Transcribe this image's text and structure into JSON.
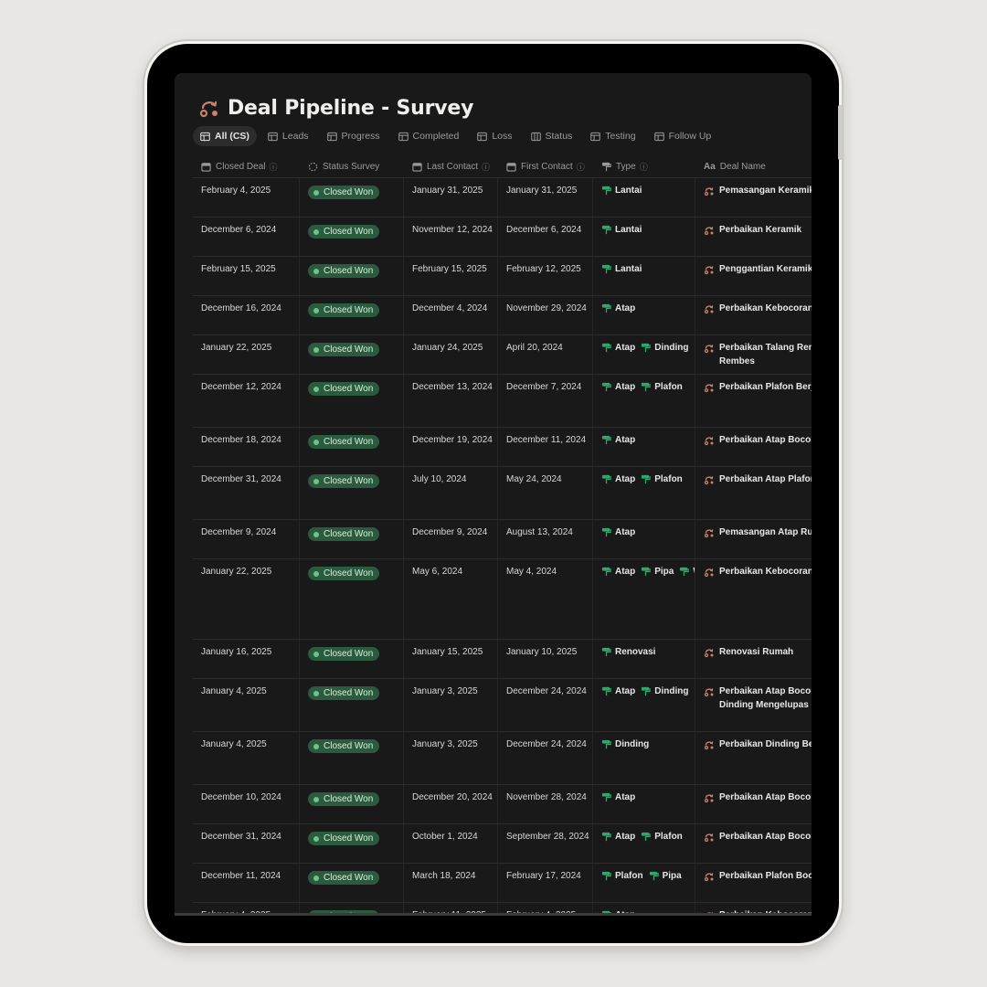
{
  "page": {
    "title": "Deal Pipeline - Survey"
  },
  "tabs": [
    {
      "label": "All (CS)",
      "active": true
    },
    {
      "label": "Leads"
    },
    {
      "label": "Progress"
    },
    {
      "label": "Completed"
    },
    {
      "label": "Loss"
    },
    {
      "label": "Status"
    },
    {
      "label": "Testing"
    },
    {
      "label": "Follow Up"
    }
  ],
  "columns": [
    "Closed Deal",
    "Status Survey",
    "Last Contact",
    "First Contact",
    "Type",
    "Deal Name"
  ],
  "rows": [
    {
      "closed": "February 4, 2025",
      "status": "Closed Won",
      "last": "January 31, 2025",
      "first": "January 31, 2025",
      "types": [
        "Lantai"
      ],
      "deal": "Pemasangan Keramik",
      "h": 42
    },
    {
      "closed": "December 6, 2024",
      "status": "Closed Won",
      "last": "November 12, 2024",
      "first": "December 6, 2024",
      "types": [
        "Lantai"
      ],
      "deal": "Perbaikan Keramik",
      "h": 42
    },
    {
      "closed": "February 15, 2025",
      "status": "Closed Won",
      "last": "February 15, 2025",
      "first": "February 12, 2025",
      "types": [
        "Lantai"
      ],
      "deal": "Penggantian Keramik",
      "h": 42
    },
    {
      "closed": "December 16, 2024",
      "status": "Closed Won",
      "last": "December 4, 2024",
      "first": "November 29, 2024",
      "types": [
        "Atap"
      ],
      "deal": "Perbaikan Kebocoran A",
      "h": 42
    },
    {
      "closed": "January 22, 2025",
      "status": "Closed Won",
      "last": "January 24, 2025",
      "first": "April 20, 2024",
      "types": [
        "Atap",
        "Dinding"
      ],
      "deal": "Perbaikan Talang Rembe\nRembes",
      "h": 42
    },
    {
      "closed": "December 12, 2024",
      "status": "Closed Won",
      "last": "December 13, 2024",
      "first": "December 7, 2024",
      "types": [
        "Atap",
        "Plafon"
      ],
      "deal": "Perbaikan Plafon Berja",
      "h": 57
    },
    {
      "closed": "December 18, 2024",
      "status": "Closed Won",
      "last": "December 19, 2024",
      "first": "December 11, 2024",
      "types": [
        "Atap"
      ],
      "deal": "Perbaikan Atap Bocor",
      "h": 42
    },
    {
      "closed": "December 31, 2024",
      "status": "Closed Won",
      "last": "July 10, 2024",
      "first": "May 24, 2024",
      "types": [
        "Atap",
        "Plafon"
      ],
      "deal": "Perbaikan Atap Plafon",
      "h": 57
    },
    {
      "closed": "December 9, 2024",
      "status": "Closed Won",
      "last": "December 9, 2024",
      "first": "August 13, 2024",
      "types": [
        "Atap"
      ],
      "deal": "Pemasangan Atap Rum",
      "h": 42
    },
    {
      "closed": "January 22, 2025",
      "status": "Closed Won",
      "last": "May 6, 2024",
      "first": "May 4, 2024",
      "types": [
        "Atap",
        "Pipa",
        "W"
      ],
      "deal": "Perbaikan Kebocoran",
      "h": 87
    },
    {
      "closed": "January 16, 2025",
      "status": "Closed Won",
      "last": "January 15, 2025",
      "first": "January 10, 2025",
      "types": [
        "Renovasi"
      ],
      "deal": "Renovasi Rumah",
      "h": 42
    },
    {
      "closed": "January 4, 2025",
      "status": "Closed Won",
      "last": "January 3, 2025",
      "first": "December 24, 2024",
      "types": [
        "Atap",
        "Dinding"
      ],
      "deal": "Perbaikan Atap Bocor,\nDinding Mengelupas d",
      "h": 57
    },
    {
      "closed": "January 4, 2025",
      "status": "Closed Won",
      "last": "January 3, 2025",
      "first": "December 24, 2024",
      "types": [
        "Dinding"
      ],
      "deal": "Perbaikan Dinding Ber",
      "h": 57
    },
    {
      "closed": "December 10, 2024",
      "status": "Closed Won",
      "last": "December 20, 2024",
      "first": "November 28, 2024",
      "types": [
        "Atap"
      ],
      "deal": "Perbaikan Atap Bocor",
      "h": 42
    },
    {
      "closed": "December 31, 2024",
      "status": "Closed Won",
      "last": "October 1, 2024",
      "first": "September 28, 2024",
      "types": [
        "Atap",
        "Plafon"
      ],
      "deal": "Perbaikan Atap Bocor",
      "h": 42
    },
    {
      "closed": "December 11, 2024",
      "status": "Closed Won",
      "last": "March 18, 2024",
      "first": "February 17, 2024",
      "types": [
        "Plafon",
        "Pipa"
      ],
      "deal": "Perbaikan Plafon Boco",
      "h": 42
    },
    {
      "closed": "February 4, 2025",
      "status": "Closed Won",
      "last": "February 11, 2025",
      "first": "February 4, 2025",
      "types": [
        "Atap"
      ],
      "deal": "Perbaikan Kebocoran",
      "h": 42
    }
  ],
  "colors": {
    "badge_bg": "#2b5a3e",
    "badge_dot": "#6cc38c",
    "type_icon": "#2fa86a",
    "deal_icon": "#c9826b"
  }
}
